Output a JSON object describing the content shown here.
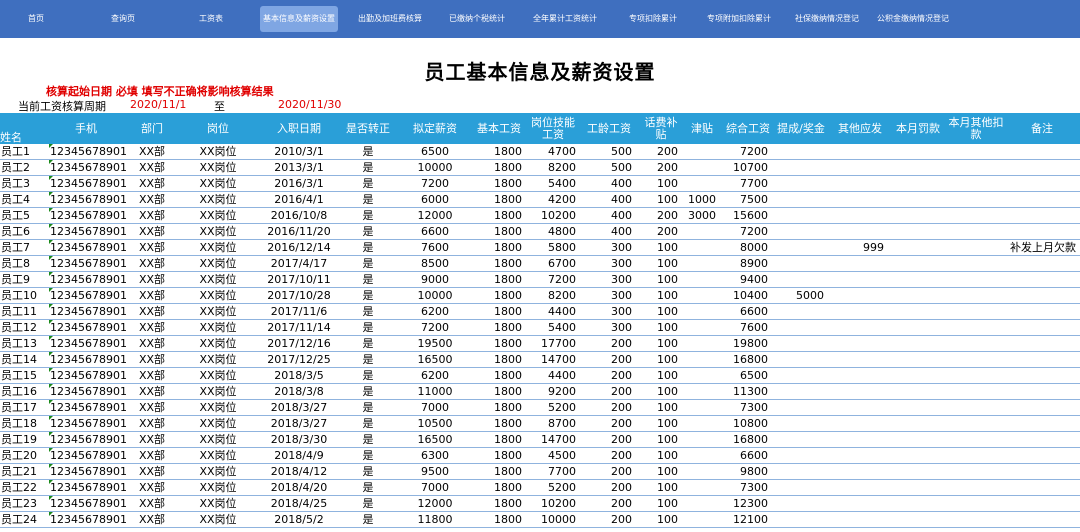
{
  "nav": {
    "items": [
      "首页",
      "查询页",
      "工资表",
      "基本信息及薪资设置",
      "出勤及加班费核算",
      "已缴纳个税统计",
      "全年累计工资统计",
      "专项扣除累计",
      "专项附加扣除累计",
      "社保缴纳情况登记",
      "公积金缴纳情况登记"
    ],
    "active_index": 3
  },
  "page": {
    "title": "员工基本信息及薪资设置",
    "warning": "核算起始日期 必填 填写不正确将影响核算结果",
    "period_label": "当前工资核算周期",
    "period_start": "2020/11/1",
    "period_to": "至",
    "period_end": "2020/11/30"
  },
  "table": {
    "headers": [
      "姓名",
      "手机",
      "部门",
      "岗位",
      "入职日期",
      "是否转正",
      "拟定薪资",
      "基本工资",
      "岗位技能工资",
      "工龄工资",
      "话费补贴",
      "津贴",
      "综合工资",
      "提成/奖金",
      "其他应发",
      "本月罚款",
      "本月其他扣款",
      "备注"
    ],
    "rows": [
      [
        "员工1",
        "12345678901",
        "XX部",
        "XX岗位",
        "2010/3/1",
        "是",
        "6500",
        "1800",
        "4700",
        "500",
        "200",
        "",
        "7200",
        "",
        "",
        "",
        "",
        ""
      ],
      [
        "员工2",
        "12345678901",
        "XX部",
        "XX岗位",
        "2013/3/1",
        "是",
        "10000",
        "1800",
        "8200",
        "500",
        "200",
        "",
        "10700",
        "",
        "",
        "",
        "",
        ""
      ],
      [
        "员工3",
        "12345678901",
        "XX部",
        "XX岗位",
        "2016/3/1",
        "是",
        "7200",
        "1800",
        "5400",
        "400",
        "100",
        "",
        "7700",
        "",
        "",
        "",
        "",
        ""
      ],
      [
        "员工4",
        "12345678901",
        "XX部",
        "XX岗位",
        "2016/4/1",
        "是",
        "6000",
        "1800",
        "4200",
        "400",
        "100",
        "1000",
        "7500",
        "",
        "",
        "",
        "",
        ""
      ],
      [
        "员工5",
        "12345678901",
        "XX部",
        "XX岗位",
        "2016/10/8",
        "是",
        "12000",
        "1800",
        "10200",
        "400",
        "200",
        "3000",
        "15600",
        "",
        "",
        "",
        "",
        ""
      ],
      [
        "员工6",
        "12345678901",
        "XX部",
        "XX岗位",
        "2016/11/20",
        "是",
        "6600",
        "1800",
        "4800",
        "400",
        "200",
        "",
        "7200",
        "",
        "",
        "",
        "",
        ""
      ],
      [
        "员工7",
        "12345678901",
        "XX部",
        "XX岗位",
        "2016/12/14",
        "是",
        "7600",
        "1800",
        "5800",
        "300",
        "100",
        "",
        "8000",
        "",
        "999",
        "",
        "",
        "补发上月欠款"
      ],
      [
        "员工8",
        "12345678901",
        "XX部",
        "XX岗位",
        "2017/4/17",
        "是",
        "8500",
        "1800",
        "6700",
        "300",
        "100",
        "",
        "8900",
        "",
        "",
        "",
        "",
        ""
      ],
      [
        "员工9",
        "12345678901",
        "XX部",
        "XX岗位",
        "2017/10/11",
        "是",
        "9000",
        "1800",
        "7200",
        "300",
        "100",
        "",
        "9400",
        "",
        "",
        "",
        "",
        ""
      ],
      [
        "员工10",
        "12345678901",
        "XX部",
        "XX岗位",
        "2017/10/28",
        "是",
        "10000",
        "1800",
        "8200",
        "300",
        "100",
        "",
        "10400",
        "5000",
        "",
        "",
        "",
        ""
      ],
      [
        "员工11",
        "12345678901",
        "XX部",
        "XX岗位",
        "2017/11/6",
        "是",
        "6200",
        "1800",
        "4400",
        "300",
        "100",
        "",
        "6600",
        "",
        "",
        "",
        "",
        ""
      ],
      [
        "员工12",
        "12345678901",
        "XX部",
        "XX岗位",
        "2017/11/14",
        "是",
        "7200",
        "1800",
        "5400",
        "300",
        "100",
        "",
        "7600",
        "",
        "",
        "",
        "",
        ""
      ],
      [
        "员工13",
        "12345678901",
        "XX部",
        "XX岗位",
        "2017/12/16",
        "是",
        "19500",
        "1800",
        "17700",
        "200",
        "100",
        "",
        "19800",
        "",
        "",
        "",
        "",
        ""
      ],
      [
        "员工14",
        "12345678901",
        "XX部",
        "XX岗位",
        "2017/12/25",
        "是",
        "16500",
        "1800",
        "14700",
        "200",
        "100",
        "",
        "16800",
        "",
        "",
        "",
        "",
        ""
      ],
      [
        "员工15",
        "12345678901",
        "XX部",
        "XX岗位",
        "2018/3/5",
        "是",
        "6200",
        "1800",
        "4400",
        "200",
        "100",
        "",
        "6500",
        "",
        "",
        "",
        "",
        ""
      ],
      [
        "员工16",
        "12345678901",
        "XX部",
        "XX岗位",
        "2018/3/8",
        "是",
        "11000",
        "1800",
        "9200",
        "200",
        "100",
        "",
        "11300",
        "",
        "",
        "",
        "",
        ""
      ],
      [
        "员工17",
        "12345678901",
        "XX部",
        "XX岗位",
        "2018/3/27",
        "是",
        "7000",
        "1800",
        "5200",
        "200",
        "100",
        "",
        "7300",
        "",
        "",
        "",
        "",
        ""
      ],
      [
        "员工18",
        "12345678901",
        "XX部",
        "XX岗位",
        "2018/3/27",
        "是",
        "10500",
        "1800",
        "8700",
        "200",
        "100",
        "",
        "10800",
        "",
        "",
        "",
        "",
        ""
      ],
      [
        "员工19",
        "12345678901",
        "XX部",
        "XX岗位",
        "2018/3/30",
        "是",
        "16500",
        "1800",
        "14700",
        "200",
        "100",
        "",
        "16800",
        "",
        "",
        "",
        "",
        ""
      ],
      [
        "员工20",
        "12345678901",
        "XX部",
        "XX岗位",
        "2018/4/9",
        "是",
        "6300",
        "1800",
        "4500",
        "200",
        "100",
        "",
        "6600",
        "",
        "",
        "",
        "",
        ""
      ],
      [
        "员工21",
        "12345678901",
        "XX部",
        "XX岗位",
        "2018/4/12",
        "是",
        "9500",
        "1800",
        "7700",
        "200",
        "100",
        "",
        "9800",
        "",
        "",
        "",
        "",
        ""
      ],
      [
        "员工22",
        "12345678901",
        "XX部",
        "XX岗位",
        "2018/4/20",
        "是",
        "7000",
        "1800",
        "5200",
        "200",
        "100",
        "",
        "7300",
        "",
        "",
        "",
        "",
        ""
      ],
      [
        "员工23",
        "12345678901",
        "XX部",
        "XX岗位",
        "2018/4/25",
        "是",
        "12000",
        "1800",
        "10200",
        "200",
        "100",
        "",
        "12300",
        "",
        "",
        "",
        "",
        ""
      ],
      [
        "员工24",
        "12345678901",
        "XX部",
        "XX岗位",
        "2018/5/2",
        "是",
        "11800",
        "1800",
        "10000",
        "200",
        "100",
        "",
        "12100",
        "",
        "",
        "",
        "",
        ""
      ]
    ]
  }
}
